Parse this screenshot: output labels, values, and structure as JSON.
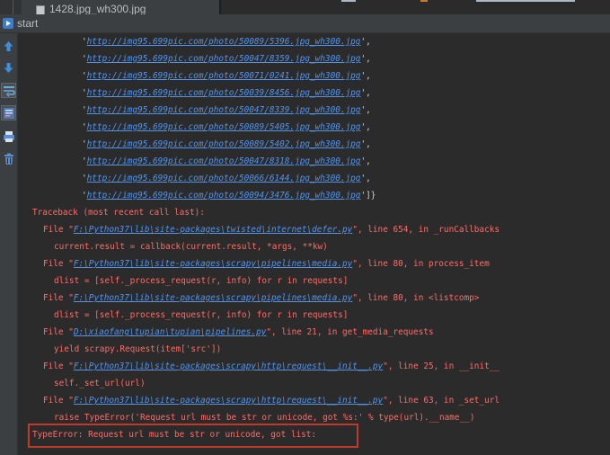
{
  "top_strip": {
    "tab_label": "1428.jpg_wh300.jpg",
    "file_icon": "file-image-icon"
  },
  "run_window": {
    "title": "start",
    "icon": "run-config-icon"
  },
  "toolbar": {
    "buttons": [
      {
        "name": "up-arrow-icon"
      },
      {
        "name": "down-arrow-icon"
      },
      {
        "name": "soft-wrap-icon"
      },
      {
        "name": "scroll-to-end-icon"
      },
      {
        "name": "print-icon"
      },
      {
        "name": "trash-icon"
      }
    ]
  },
  "console": {
    "urls": [
      "http://img95.699pic.com/photo/50089/5396.jpg_wh300.jpg",
      "http://img95.699pic.com/photo/50047/8359.jpg_wh300.jpg",
      "http://img95.699pic.com/photo/50071/0241.jpg_wh300.jpg",
      "http://img95.699pic.com/photo/50039/8456.jpg_wh300.jpg",
      "http://img95.699pic.com/photo/50047/8339.jpg_wh300.jpg",
      "http://img95.699pic.com/photo/50089/5405.jpg_wh300.jpg",
      "http://img95.699pic.com/photo/50089/5402.jpg_wh300.jpg",
      "http://img95.699pic.com/photo/50047/8318.jpg_wh300.jpg",
      "http://img95.699pic.com/photo/50066/6144.jpg_wh300.jpg",
      "http://img95.699pic.com/photo/50094/3476.jpg_wh300.jpg"
    ],
    "list_end": "]}",
    "traceback_header": "Traceback (most recent call last):",
    "frames": [
      {
        "file": "F:\\Python37\\lib\\site-packages\\twisted\\internet\\defer.py",
        "loc": ", line 654, in _runCallbacks",
        "code": "current.result = callback(current.result, *args, **kw)"
      },
      {
        "file": "F:\\Python37\\lib\\site-packages\\scrapy\\pipelines\\media.py",
        "loc": ", line 80, in process_item",
        "code": "dlist = [self._process_request(r, info) for r in requests]"
      },
      {
        "file": "F:\\Python37\\lib\\site-packages\\scrapy\\pipelines\\media.py",
        "loc": ", line 80, in <listcomp>",
        "code": "dlist = [self._process_request(r, info) for r in requests]"
      },
      {
        "file": "D:\\xiaofang\\tupian\\tupian\\pipelines.py",
        "loc": ", line 21, in get_media_requests",
        "code": "yield scrapy.Request(item['src'])"
      },
      {
        "file": "F:\\Python37\\lib\\site-packages\\scrapy\\http\\request\\__init__.py",
        "loc": ", line 25, in __init__",
        "code": "self._set_url(url)"
      },
      {
        "file": "F:\\Python37\\lib\\site-packages\\scrapy\\http\\request\\__init__.py",
        "loc": ", line 63, in _set_url",
        "code": "raise TypeError('Request url must be str or unicode, got %s:' % type(url).__name__)"
      }
    ],
    "file_prefix": "File \"",
    "file_suffix": "\"",
    "final_error": "TypeError: Request url must be str or unicode, got list:"
  },
  "colors": {
    "background": "#2b2b2b",
    "error_text": "#ff6b68",
    "link": "#5394ec",
    "plain_text": "#d4d4d4",
    "highlight_box": "#c0392b",
    "accent_blue": "#3e7cc7"
  }
}
